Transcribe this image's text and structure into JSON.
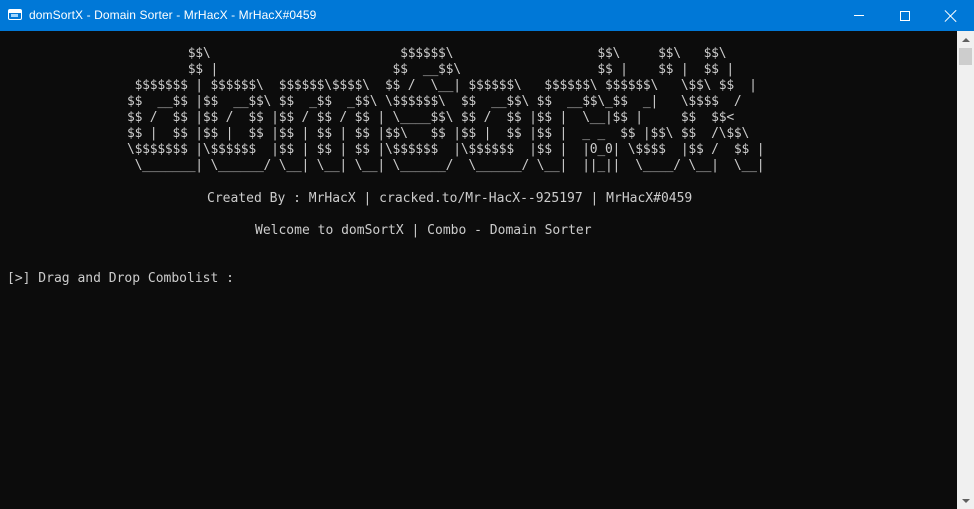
{
  "window": {
    "title": "domSortX - Domain Sorter - MrHacX - MrHacX#0459",
    "titlebar_color": "#0078d7",
    "icon": "console-app-icon",
    "controls": [
      "minimize-icon",
      "maximize-icon",
      "close-icon"
    ]
  },
  "console": {
    "background": "#0c0c0c",
    "text_color": "#cccccc",
    "banner": "        $$\\                         $$$$$$\\                   $$\\     $$\\   $$\\\n        $$ |                       $$  __$$\\                  $$ |    $$ |  $$ |\n $$$$$$$ | $$$$$$\\  $$$$$$\\$$$$\\  $$ /  \\__| $$$$$$\\   $$$$$$\\ $$$$$$\\   \\$$\\ $$  |\n$$  __$$ |$$  __$$\\ $$  _$$  _$$\\ \\$$$$$$\\  $$  __$$\\ $$  __$$\\_$$  _|   \\$$$$  /\n$$ /  $$ |$$ /  $$ |$$ / $$ / $$ | \\____$$\\ $$ /  $$ |$$ |  \\__|$$ |     $$  $$<\n$$ |  $$ |$$ |  $$ |$$ | $$ | $$ |$$\\   $$ |$$ |  $$ |$$ |  _ _  $$ |$$\\ $$  /\\$$\\\n\\$$$$$$$ |\\$$$$$$  |$$ | $$ | $$ |\\$$$$$$  |\\$$$$$$  |$$ |  |0_0| \\$$$$  |$$ /  $$ |\n \\_______| \\______/ \\__| \\__| \\__| \\______/  \\______/ \\__|  ||_||  \\____/ \\__|  \\__|",
    "credits": "Created By : MrHacX | cracked.to/Mr-HacX--925197 | MrHacX#0459",
    "welcome": "Welcome to domSortX | Combo - Domain Sorter",
    "prompt": "[>] Drag and Drop Combolist :"
  },
  "scrollbar": {
    "up_icon": "scroll-up-arrow-icon",
    "down_icon": "scroll-down-arrow-icon"
  }
}
